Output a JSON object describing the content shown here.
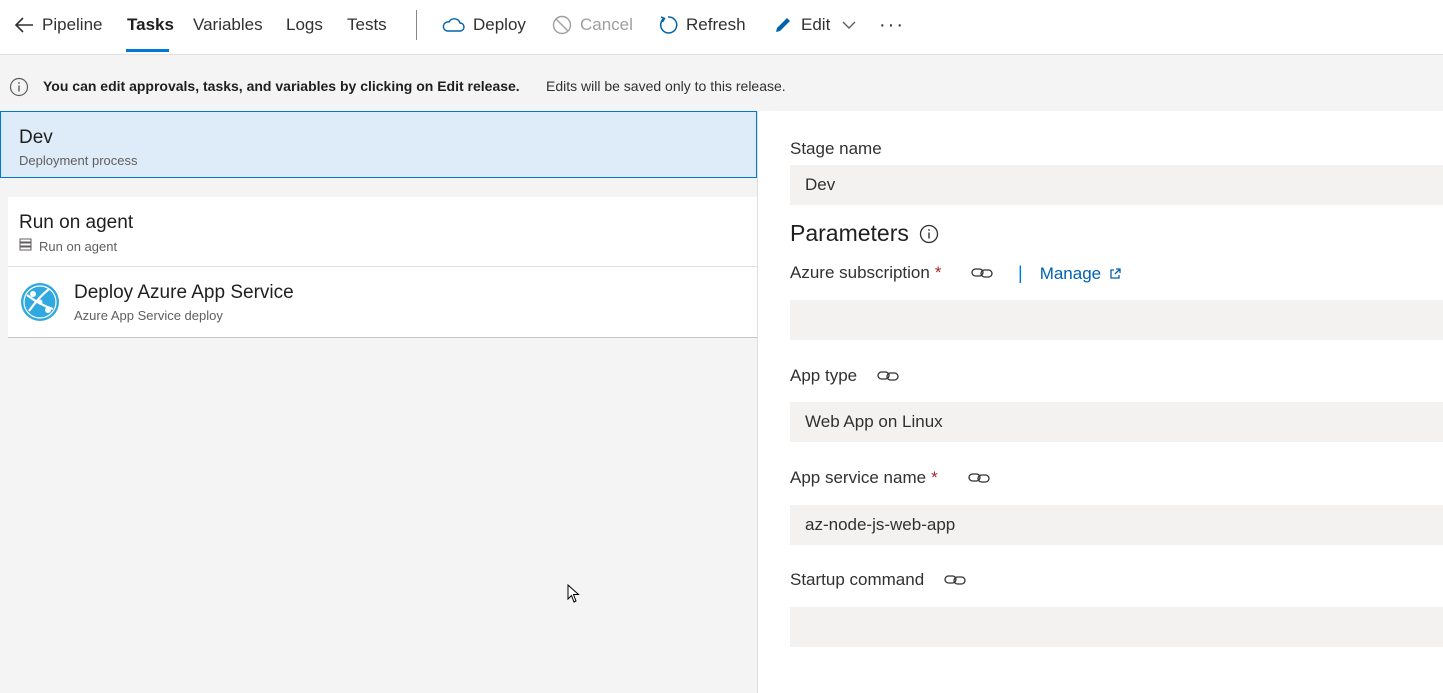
{
  "topbar": {
    "back_label": "Pipeline",
    "tabs": [
      {
        "label": "Tasks",
        "active": true
      },
      {
        "label": "Variables",
        "active": false
      },
      {
        "label": "Logs",
        "active": false
      },
      {
        "label": "Tests",
        "active": false
      }
    ],
    "actions": {
      "deploy": "Deploy",
      "cancel": "Cancel",
      "refresh": "Refresh",
      "edit": "Edit",
      "more": "···"
    }
  },
  "infobar": {
    "bold_text": "You can edit approvals, tasks, and variables by clicking on Edit release.",
    "rest_text": "Edits will be saved only to this release."
  },
  "left": {
    "stage": {
      "title": "Dev",
      "subtitle": "Deployment process"
    },
    "agent": {
      "title": "Run on agent",
      "subtitle": "Run on agent"
    },
    "task": {
      "title": "Deploy Azure App Service",
      "subtitle": "Azure App Service deploy"
    }
  },
  "right": {
    "stage_name_label": "Stage name",
    "stage_name_value": "Dev",
    "parameters_title": "Parameters",
    "azure_subscription_label": "Azure subscription",
    "azure_subscription_value": "",
    "manage_label": "Manage",
    "app_type_label": "App type",
    "app_type_value": "Web App on Linux",
    "app_service_name_label": "App service name",
    "app_service_name_value": "az-node-js-web-app",
    "startup_command_label": "Startup command",
    "startup_command_value": "",
    "required_mark": "*"
  },
  "colors": {
    "accent": "#0078d4",
    "selected_bg": "#deecf9",
    "required": "#a4262c",
    "panel_bg": "#f4f4f4"
  }
}
